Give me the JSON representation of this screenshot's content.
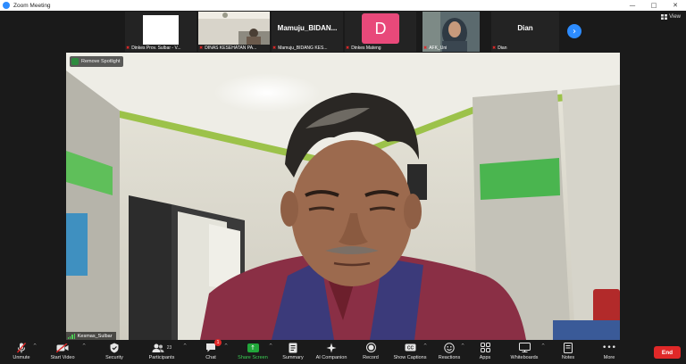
{
  "window": {
    "title": "Zoom Meeting",
    "controls": [
      "—",
      "□",
      "✕"
    ]
  },
  "view_button": {
    "label": "View",
    "icon": "grid-icon"
  },
  "participants_strip": [
    {
      "name": "Dinkes Prov. Sulbar - V...",
      "video": "white-box",
      "muted": true
    },
    {
      "name": "DINAS KESEHATAN PA...",
      "video": "meeting-room",
      "muted": true
    },
    {
      "name": "Mamuju_BIDANG KES...",
      "video": "name-only",
      "display_text": "Mamuju_BIDAN...",
      "muted": true
    },
    {
      "name": "Dinkes Mateng",
      "video": "avatar",
      "avatar_letter": "D",
      "avatar_color": "#e8497a",
      "muted": true
    },
    {
      "name": "AFK_Uni",
      "video": "woman-hijab",
      "muted": true
    },
    {
      "name": "Dian",
      "video": "name-only",
      "display_text": "Dian",
      "muted": true
    }
  ],
  "next_page_icon": "›",
  "spotlight": {
    "label": "Remove Spotlight"
  },
  "active_speaker": {
    "name": "Kesmas_Sulbar"
  },
  "toolbar": {
    "items": [
      {
        "key": "unmute",
        "label": "Unmute",
        "icon": "mic-muted-icon",
        "caret": true
      },
      {
        "key": "video",
        "label": "Start Video",
        "icon": "video-off-icon",
        "caret": true
      },
      {
        "key": "security",
        "label": "Security",
        "icon": "shield-icon",
        "caret": false
      },
      {
        "key": "participants",
        "label": "Participants",
        "icon": "participants-icon",
        "count": "23",
        "caret": true
      },
      {
        "key": "chat",
        "label": "Chat",
        "icon": "chat-icon",
        "badge": "1",
        "caret": true
      },
      {
        "key": "share",
        "label": "Share Screen",
        "icon": "share-screen-icon",
        "caret": true
      },
      {
        "key": "summary",
        "label": "Summary",
        "icon": "summary-icon",
        "caret": false
      },
      {
        "key": "ai",
        "label": "AI Companion",
        "icon": "sparkle-icon",
        "caret": false
      },
      {
        "key": "record",
        "label": "Record",
        "icon": "record-icon",
        "caret": false
      },
      {
        "key": "captions",
        "label": "Show Captions",
        "icon": "cc-icon",
        "caret": true
      },
      {
        "key": "reactions",
        "label": "Reactions",
        "icon": "emoji-icon",
        "caret": true
      },
      {
        "key": "apps",
        "label": "Apps",
        "icon": "apps-icon",
        "caret": false
      },
      {
        "key": "whiteboards",
        "label": "Whiteboards",
        "icon": "whiteboard-icon",
        "caret": true
      },
      {
        "key": "notes",
        "label": "Notes",
        "icon": "notes-icon",
        "caret": false
      },
      {
        "key": "more",
        "label": "More",
        "icon": "more-icon",
        "caret": false
      }
    ],
    "end_label": "End"
  },
  "colors": {
    "accent": "#2d8cff",
    "end": "#e02828",
    "share": "#21a63a",
    "muted_mic": "#e02828"
  }
}
